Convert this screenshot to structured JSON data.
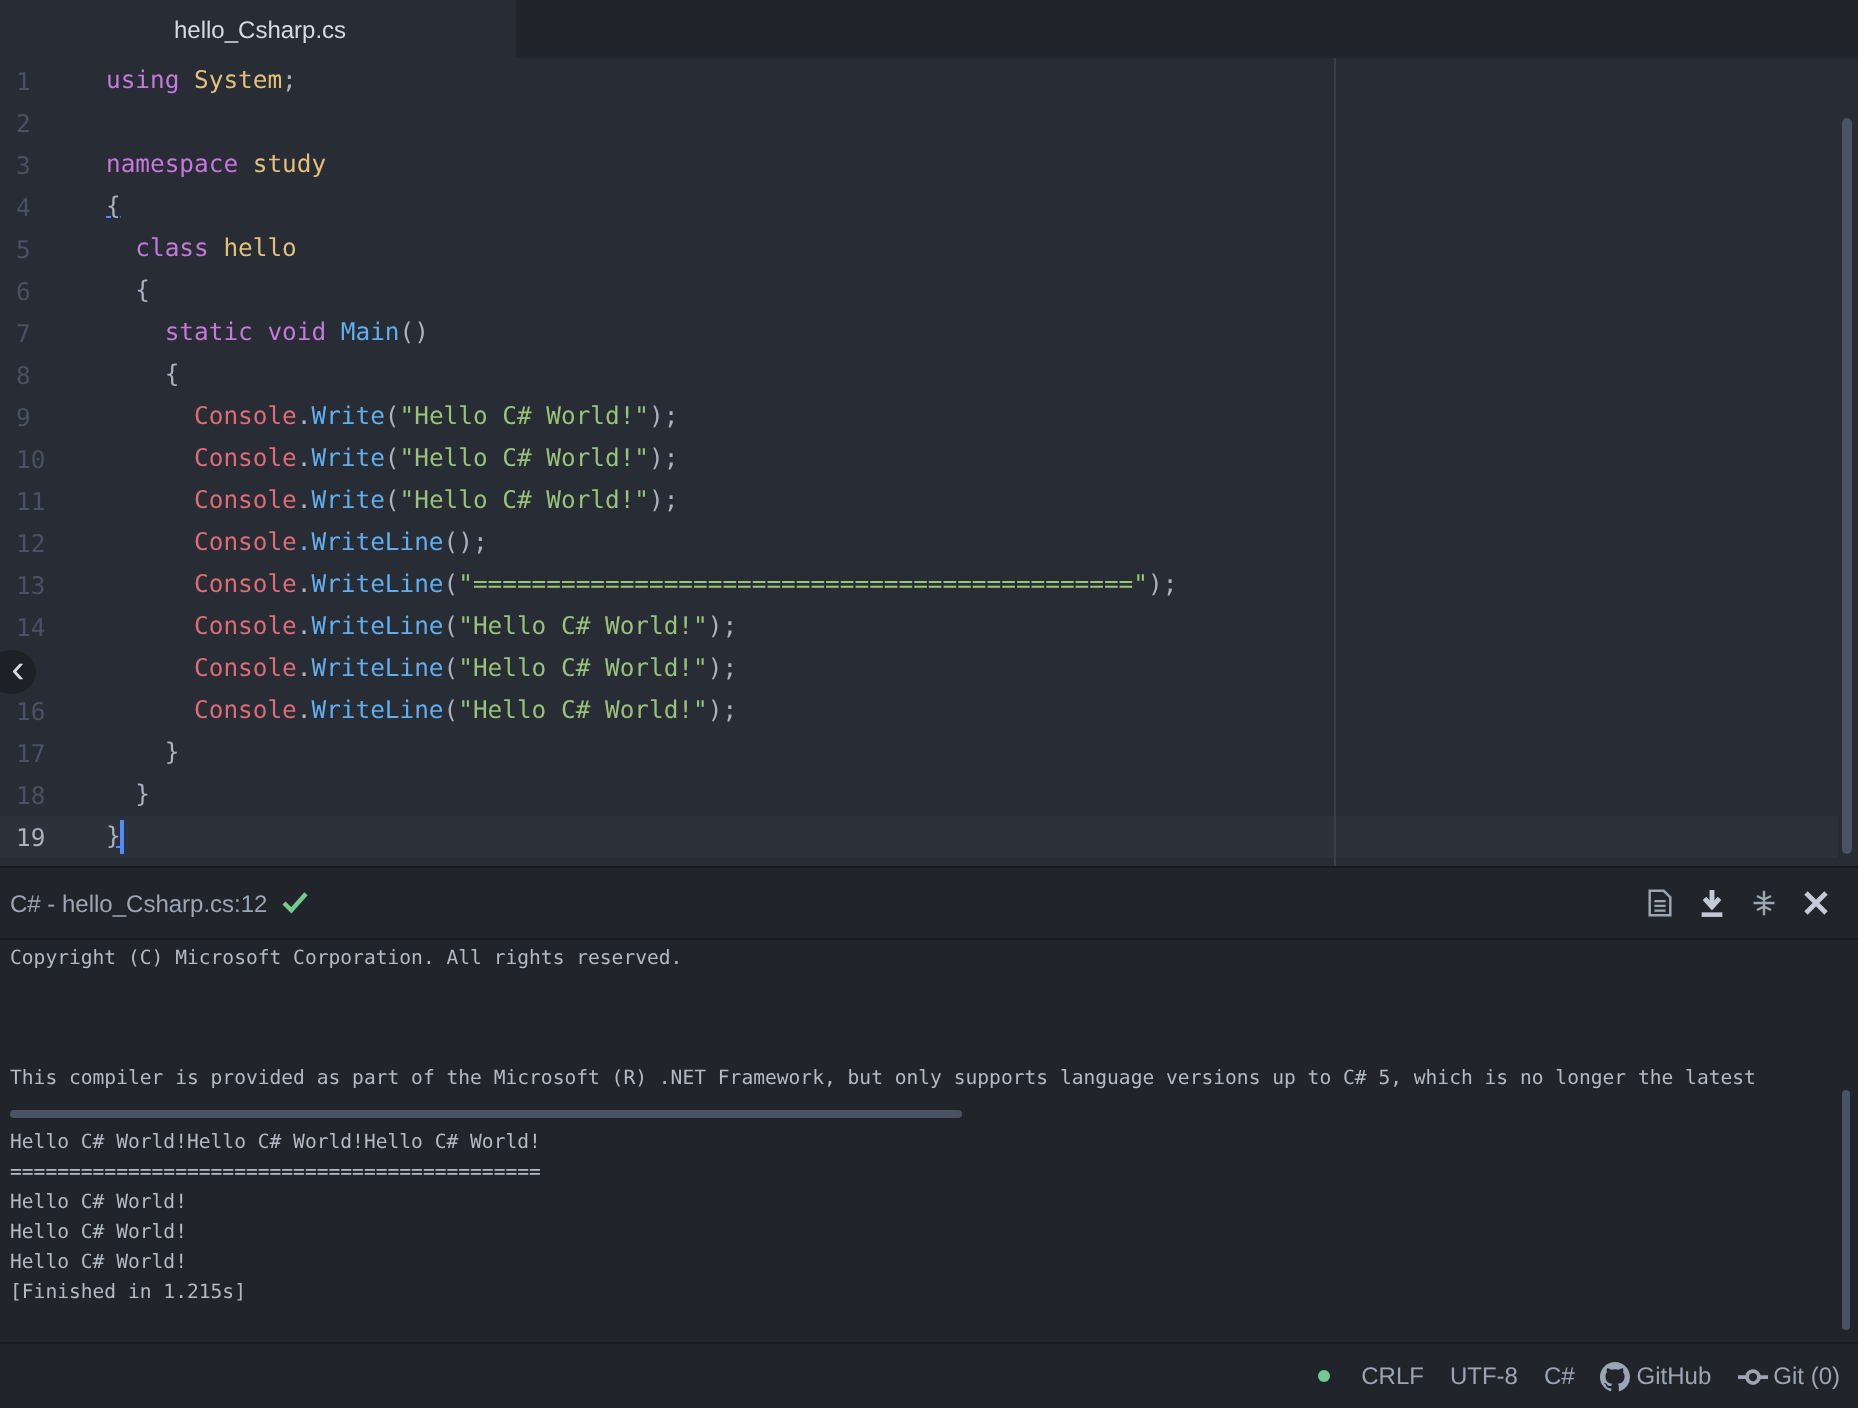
{
  "tabs": [
    {
      "label": "hello_Csharp.cs",
      "selected": true
    }
  ],
  "editor": {
    "lines": [
      {
        "number": "1",
        "current": false,
        "tokens": [
          {
            "text": "using",
            "kind": "keyword"
          },
          {
            "text": "System",
            "kind": "type"
          },
          {
            "text": ";",
            "kind": "plain"
          }
        ]
      },
      {
        "number": "2",
        "current": false
      },
      {
        "number": "3",
        "current": false,
        "tokens": [
          {
            "text": "namespace",
            "kind": "keyword"
          },
          {
            "text": "study",
            "kind": "type"
          }
        ]
      },
      {
        "number": "4",
        "current": false,
        "tokens": [
          {
            "text": "{",
            "kind": "open_brace"
          }
        ]
      },
      {
        "number": "5",
        "current": false,
        "tokens": [
          {
            "text": "class",
            "kind": "keyword"
          },
          {
            "text": "hello",
            "kind": "type"
          }
        ]
      },
      {
        "number": "6",
        "current": false,
        "tokens": [
          {
            "text": "{",
            "kind": "open_brace"
          }
        ]
      },
      {
        "number": "7",
        "current": false,
        "tokens": [
          {
            "text": "static void",
            "kind": "keyword"
          },
          {
            "text": "Main",
            "kind": "method"
          },
          {
            "text": "()",
            "kind": "plain"
          }
        ]
      },
      {
        "number": "8",
        "current": false,
        "tokens": [
          {
            "text": "{",
            "kind": "open_brace"
          }
        ]
      },
      {
        "number": "9",
        "current": false,
        "tokens": [
          {
            "text": "Console",
            "kind": "class"
          },
          {
            "text": ".",
            "kind": "plain"
          },
          {
            "text": "Write",
            "kind": "method"
          },
          {
            "text": "(",
            "kind": "plain"
          },
          {
            "text": "\"Hello C# World!\"",
            "kind": "string"
          },
          {
            "text": ");",
            "kind": "plain"
          }
        ]
      },
      {
        "number": "10",
        "current": false,
        "tokens": [
          {
            "text": "Console",
            "kind": "class"
          },
          {
            "text": ".",
            "kind": "plain"
          },
          {
            "text": "Write",
            "kind": "method"
          },
          {
            "text": "(",
            "kind": "plain"
          },
          {
            "text": "\"Hello C# World!\"",
            "kind": "string"
          },
          {
            "text": ");",
            "kind": "plain"
          }
        ]
      },
      {
        "number": "11",
        "current": false,
        "tokens": [
          {
            "text": "Console",
            "kind": "class"
          },
          {
            "text": ".",
            "kind": "plain"
          },
          {
            "text": "Write",
            "kind": "method"
          },
          {
            "text": "(",
            "kind": "plain"
          },
          {
            "text": "\"Hello C# World!\"",
            "kind": "string"
          },
          {
            "text": ");",
            "kind": "plain"
          }
        ]
      },
      {
        "number": "12",
        "current": false,
        "tokens": [
          {
            "text": "Console",
            "kind": "class"
          },
          {
            "text": ".WriteLine",
            "kind": "method"
          },
          {
            "text": "();",
            "kind": "plain"
          }
        ]
      },
      {
        "number": "13",
        "current": false,
        "tokens": [
          {
            "text": "Console",
            "kind": "class"
          },
          {
            "text": ".",
            "kind": "plain"
          },
          {
            "text": "WriteLine",
            "kind": "method"
          },
          {
            "text": "(",
            "kind": "plain"
          },
          {
            "text": "\"=============================================\"",
            "kind": "string"
          },
          {
            "text": ");",
            "kind": "plain"
          }
        ]
      },
      {
        "number": "14",
        "current": false,
        "tokens": [
          {
            "text": "Console",
            "kind": "class"
          },
          {
            "text": ".",
            "kind": "plain"
          },
          {
            "text": "WriteLine",
            "kind": "method"
          },
          {
            "text": "(",
            "kind": "plain"
          },
          {
            "text": "\"Hello C# World!\"",
            "kind": "string"
          },
          {
            "text": ");",
            "kind": "plain"
          }
        ]
      },
      {
        "current": false,
        "tokens": [
          {
            "text": "Console",
            "kind": "class"
          },
          {
            "text": ".",
            "kind": "plain"
          },
          {
            "text": "WriteLine",
            "kind": "method"
          },
          {
            "text": "(",
            "kind": "plain"
          },
          {
            "text": "\"Hello C# World!\"",
            "kind": "string"
          },
          {
            "text": ");",
            "kind": "plain"
          }
        ]
      },
      {
        "number": "16",
        "current": false,
        "tokens": [
          {
            "text": "Console",
            "kind": "class"
          },
          {
            "text": ".",
            "kind": "plain"
          },
          {
            "text": "WriteLine",
            "kind": "method"
          },
          {
            "text": "(",
            "kind": "plain"
          },
          {
            "text": "\"Hello C# World!\"",
            "kind": "string"
          },
          {
            "text": ");",
            "kind": "plain"
          }
        ]
      },
      {
        "number": "17",
        "current": false,
        "tokens": [
          {
            "text": "}",
            "kind": "close_brace"
          }
        ]
      },
      {
        "number": "18",
        "current": false,
        "tokens": [
          {
            "text": "}",
            "kind": "close_brace"
          }
        ]
      },
      {
        "number": "19",
        "current": true,
        "tokens": [
          {
            "text": "}",
            "kind": "close_brace"
          }
        ]
      }
    ]
  },
  "collapse_button": {
    "label": "‹"
  },
  "panel": {
    "title": "C# - hello_Csharp.cs:12",
    "succeeded": true,
    "output": [
      {
        "kind": "line",
        "text": "Copyright (C) Microsoft Corporation. All rights reserved."
      },
      {
        "kind": "blank"
      },
      {
        "kind": "blank"
      },
      {
        "kind": "blank"
      },
      {
        "kind": "line",
        "text": "This compiler is provided as part of the Microsoft (R) .NET Framework, but only supports language versions up to C# 5, which is no longer the latest"
      },
      {
        "kind": "hscroll"
      },
      {
        "kind": "line",
        "text": "Hello C# World!Hello C# World!Hello C# World!"
      },
      {
        "kind": "line",
        "text": "============================================="
      },
      {
        "kind": "line",
        "text": "Hello C# World!"
      },
      {
        "kind": "line",
        "text": "Hello C# World!"
      },
      {
        "kind": "line",
        "text": "Hello C# World!"
      },
      {
        "kind": "line",
        "text": "[Finished in 1.215s]"
      }
    ]
  },
  "status_bar": {
    "dot": {
      "color": "#73c990"
    },
    "items": [
      {
        "kind": "text",
        "label": "CRLF"
      },
      {
        "kind": "text",
        "label": "UTF-8"
      },
      {
        "kind": "text",
        "label": "C#"
      },
      {
        "kind": "github",
        "label": "GitHub"
      },
      {
        "kind": "git",
        "label": "Git (0)"
      }
    ]
  }
}
